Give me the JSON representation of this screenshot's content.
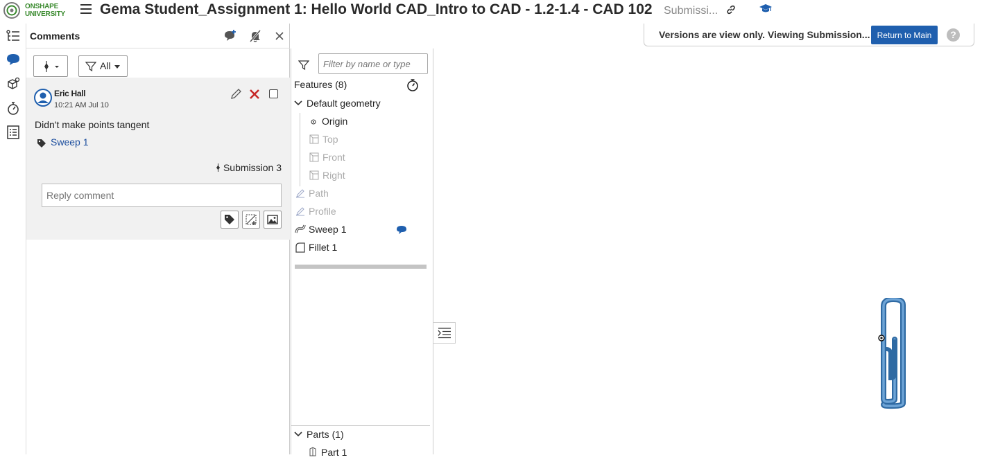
{
  "app": {
    "logo_line1": "ONSHAPE",
    "logo_line2": "UNIVERSITY",
    "title": "Gema Student_Assignment 1: Hello World CAD_Intro to CAD - 1.2-1.4 - CAD 102",
    "version_label": "Submissi..."
  },
  "banner": {
    "text": "Versions are view only. Viewing Submission...",
    "button": "Return to Main",
    "help": "?"
  },
  "comments": {
    "title": "Comments",
    "filter_all": "All",
    "author": "Eric Hall",
    "time": "10:21 AM Jul 10",
    "body": "Didn't make points tangent",
    "tag": "Sweep 1",
    "version": "Submission 3",
    "reply_placeholder": "Reply comment"
  },
  "tree": {
    "filter_placeholder": "Filter by name or type",
    "features_header": "Features (8)",
    "items": [
      {
        "label": "Default geometry",
        "icon": "chevron-down-icon"
      },
      {
        "label": "Origin",
        "icon": "origin-icon"
      },
      {
        "label": "Top",
        "icon": "plane-icon"
      },
      {
        "label": "Front",
        "icon": "plane-icon"
      },
      {
        "label": "Right",
        "icon": "plane-icon"
      },
      {
        "label": "Path",
        "icon": "sketch-icon"
      },
      {
        "label": "Profile",
        "icon": "sketch-icon"
      },
      {
        "label": "Sweep 1",
        "icon": "sweep-icon"
      },
      {
        "label": "Fillet 1",
        "icon": "fillet-icon"
      }
    ],
    "parts_header": "Parts (1)",
    "part_item": "Part 1"
  },
  "colors": {
    "accent": "#1f5fae",
    "link": "#1c4e9e",
    "delete": "#c62828",
    "model": "#4a86c0"
  }
}
